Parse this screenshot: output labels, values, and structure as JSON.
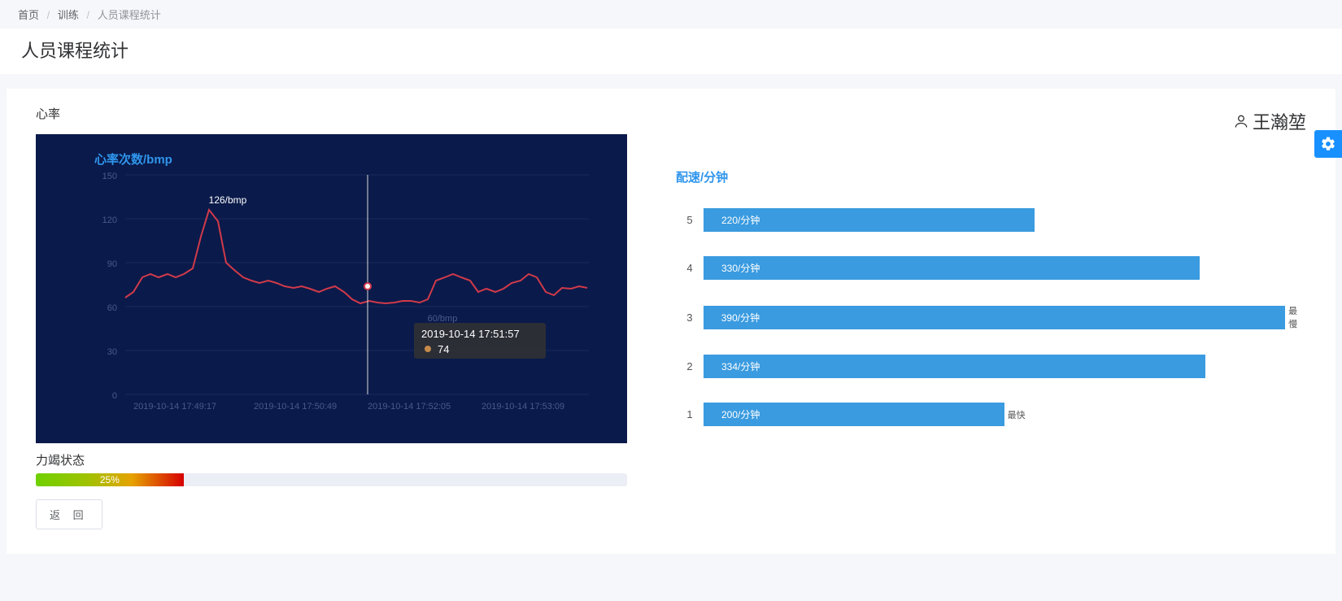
{
  "breadcrumb": {
    "home": "首页",
    "train": "训练",
    "current": "人员课程统计"
  },
  "page_title": "人员课程统计",
  "user": {
    "name": "王瀚堃"
  },
  "heart_rate": {
    "section_label": "心率",
    "chart_title": "心率次数/bmp",
    "peak_label": "126/bmp",
    "min_label": "60/bmp",
    "tooltip_time": "2019-10-14 17:51:57",
    "tooltip_value": "74"
  },
  "exhaustion": {
    "label": "力竭状态",
    "percent_text": "25%"
  },
  "back_button": "返 回",
  "pace": {
    "title": "配速/分钟",
    "rows": [
      {
        "idx": "5",
        "label": "220/分钟",
        "tag": ""
      },
      {
        "idx": "4",
        "label": "330/分钟",
        "tag": ""
      },
      {
        "idx": "3",
        "label": "390/分钟",
        "tag": "最慢"
      },
      {
        "idx": "2",
        "label": "334/分钟",
        "tag": ""
      },
      {
        "idx": "1",
        "label": "200/分钟",
        "tag": "最快"
      }
    ]
  },
  "chart_data": {
    "type": "line",
    "title": "心率次数/bmp",
    "ylabel": "",
    "xlabel": "",
    "ylim": [
      0,
      150
    ],
    "y_ticks": [
      0,
      30,
      60,
      90,
      120,
      150
    ],
    "x_ticks": [
      "2019-10-14 17:49:17",
      "2019-10-14 17:50:49",
      "2019-10-14 17:52:05",
      "2019-10-14 17:53:09"
    ],
    "series": [
      {
        "name": "心率",
        "color": "#d13a4a",
        "values": [
          66,
          70,
          80,
          82,
          80,
          82,
          80,
          82,
          86,
          108,
          126,
          118,
          90,
          85,
          80,
          78,
          76,
          78,
          76,
          74,
          73,
          74,
          72,
          70,
          72,
          74,
          70,
          65,
          62,
          64,
          63,
          62,
          63,
          64,
          64,
          63,
          65,
          78,
          80,
          82,
          80,
          78,
          70,
          72,
          70,
          72,
          76,
          78,
          82,
          80,
          70,
          68,
          73,
          72,
          74,
          73
        ]
      }
    ],
    "annotations": {
      "peak": "126/bmp",
      "min": "60/bmp",
      "tooltip": {
        "x": "2019-10-14 17:51:57",
        "y": 74
      }
    },
    "secondary_bar": {
      "type": "bar",
      "title": "配速/分钟",
      "categories": [
        "5",
        "4",
        "3",
        "2",
        "1"
      ],
      "values": [
        220,
        330,
        390,
        334,
        200
      ],
      "value_labels": [
        "220/分钟",
        "330/分钟",
        "390/分钟",
        "334/分钟",
        "200/分钟"
      ],
      "tags": {
        "3": "最慢",
        "1": "最快"
      }
    }
  }
}
